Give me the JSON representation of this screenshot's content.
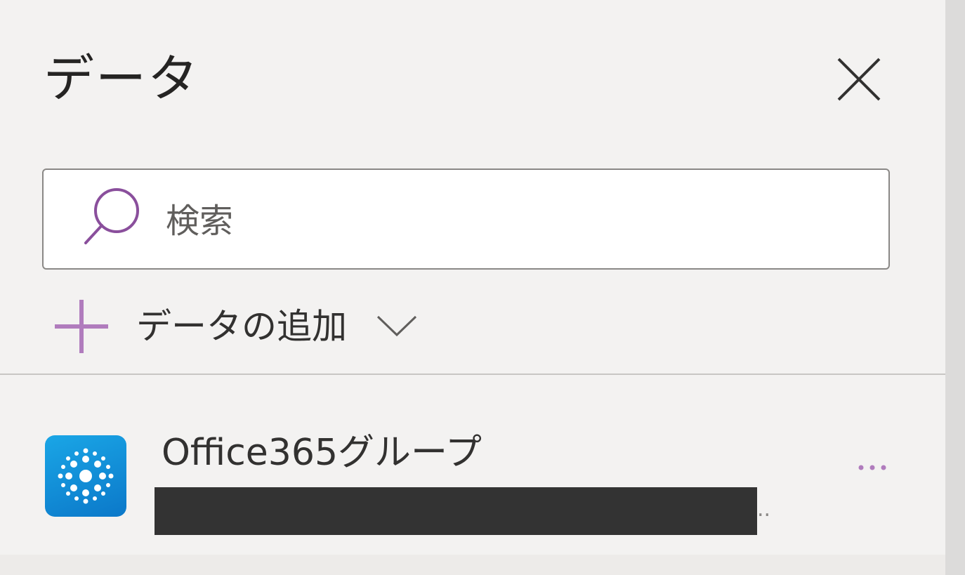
{
  "panel": {
    "title": "データ",
    "close_icon": "close-icon"
  },
  "search": {
    "placeholder": "検索",
    "value": "",
    "icon": "search-icon"
  },
  "add_data": {
    "label": "データの追加",
    "icon": "plus-icon",
    "dropdown_icon": "chevron-down-icon"
  },
  "data_sources": [
    {
      "name": "Office365グループ",
      "icon": "office365-groups-icon",
      "overflow_marker": "..",
      "more_icon": "more-icon"
    }
  ],
  "colors": {
    "accent": "#8a4f9c",
    "panel_bg": "#f3f2f1",
    "icon_blue": "#1490df"
  }
}
